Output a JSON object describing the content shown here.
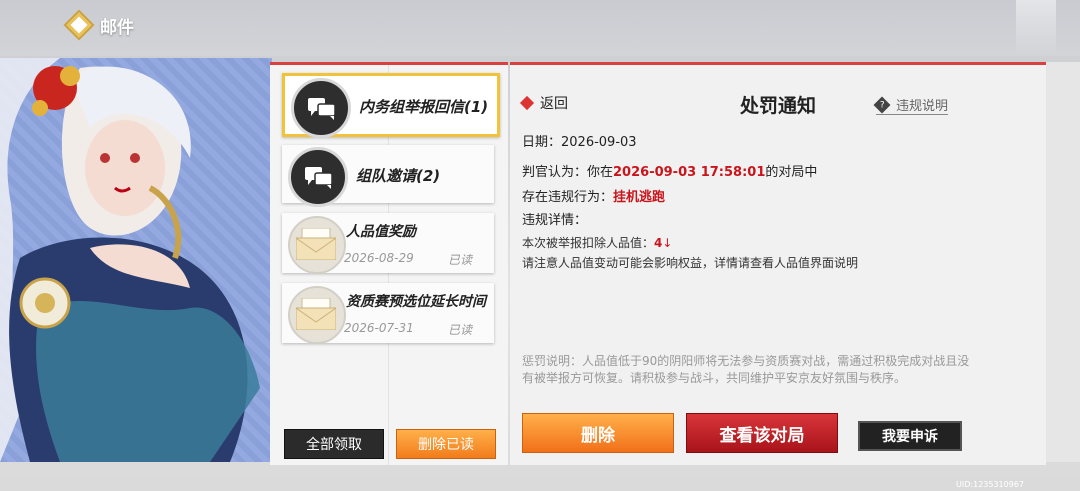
{
  "header": {
    "title": "邮件"
  },
  "mail_list": {
    "items": [
      {
        "title": "内务组举报回信(1)",
        "type": "chat",
        "selected": true
      },
      {
        "title": "组队邀请(2)",
        "type": "chat",
        "selected": false
      },
      {
        "title": "人品值奖励",
        "type": "envelope",
        "date": "2026-08-29",
        "status": "已读"
      },
      {
        "title": "资质赛预选位延长时间",
        "type": "envelope",
        "date": "2026-07-31",
        "status": "已读"
      }
    ],
    "claim_all_label": "全部领取",
    "delete_read_label": "删除已读"
  },
  "detail": {
    "back_label": "返回",
    "title": "处罚通知",
    "rules_label": "违规说明",
    "date_label": "日期：",
    "date_value": "2026-09-03",
    "judge_prefix": "判官认为：你在",
    "judge_time": "2026-09-03 17:58:01",
    "judge_suffix": "的对局中",
    "violation_label": "存在违规行为：",
    "violation_value": "挂机逃跑",
    "details_label": "违规详情：",
    "deduct_prefix": "本次被举报扣除人品值：",
    "deduct_value": "4",
    "deduct_arrow": "↓",
    "notice": "请注意人品值变动可能会影响权益，详情请查看人品值界面说明",
    "penalty_note": "惩罚说明：人品值低于90的阴阳师将无法参与资质赛对战，需通过积极完成对战且没有被举报方可恢复。请积极参与战斗，共同维护平安京友好氛围与秩序。",
    "delete_label": "删除",
    "view_match_label": "查看该对局",
    "appeal_label": "我要申诉"
  },
  "uid_text": "UID:1235310967",
  "colors": {
    "accent_red": "#d94040",
    "orange": "#f27c1b",
    "dark_red": "#a8141a",
    "highlight": "#c9141b"
  }
}
